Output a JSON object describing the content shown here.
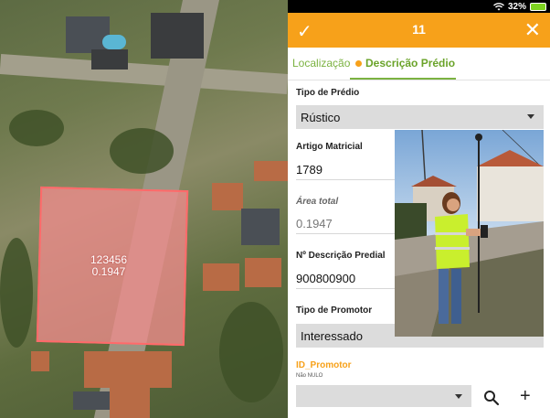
{
  "status": {
    "battery": "32%"
  },
  "map": {
    "parcel_id": "123456",
    "parcel_area": "0.1947"
  },
  "topbar": {
    "title": "11"
  },
  "tabs": [
    {
      "label": "Localização"
    },
    {
      "label": "Descrição Prédio"
    }
  ],
  "form": {
    "tipo_predio": {
      "label": "Tipo de Prédio",
      "value": "Rústico"
    },
    "artigo": {
      "label": "Artigo Matricial",
      "value": "1789"
    },
    "area": {
      "label": "Área total",
      "value": "0.1947"
    },
    "descricao": {
      "label": "Nº Descrição Predial",
      "value": "900800900"
    },
    "promotor": {
      "label": "Tipo de Promotor",
      "value": "Interessado"
    },
    "id_promotor": {
      "label": "ID_Promotor",
      "hint": "Não NULO",
      "value": ""
    }
  },
  "colors": {
    "accent": "#f7a11a",
    "tab_green": "#7bb241",
    "field_bg": "#dcdcdc"
  },
  "icons": [
    "check-icon",
    "close-icon",
    "search-icon",
    "plus-icon",
    "wifi-icon",
    "battery-icon"
  ]
}
